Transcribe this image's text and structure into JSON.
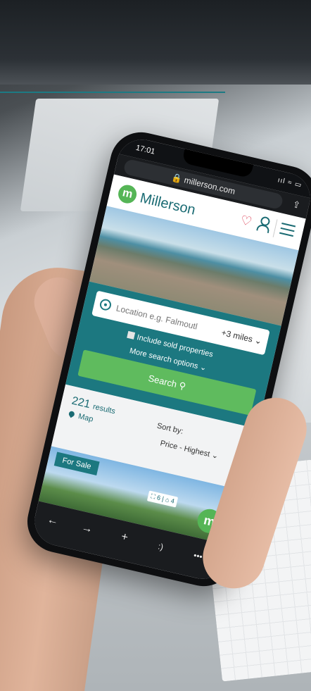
{
  "status": {
    "time": "17:01",
    "signal": "ııl ≈ ▭"
  },
  "browser": {
    "url": "millerson.com",
    "share_icon": "share-icon"
  },
  "header": {
    "brand": "Millerson",
    "logo_letter": "m",
    "favorites_icon": "heart-icon",
    "account_icon": "user-icon",
    "menu_icon": "menu-icon"
  },
  "search": {
    "location_placeholder": "Location e.g. Falmoutl",
    "radius": "+3 miles",
    "sold_label": "Include sold properties",
    "more_options": "More search options",
    "button": "Search"
  },
  "results": {
    "count": "221",
    "count_label": "results",
    "map": "Map",
    "sort_label": "Sort by:",
    "sort_value": "Price - Highest"
  },
  "listing": {
    "tag": "For Sale",
    "beds": "6",
    "baths": "4"
  },
  "toolbar": {
    "back": "←",
    "forward": "→",
    "new_tab": "+",
    "tabs": ":)",
    "more": "•••"
  },
  "colors": {
    "teal": "#1c7880",
    "green": "#5fbb5e",
    "heart": "#d9334a"
  }
}
